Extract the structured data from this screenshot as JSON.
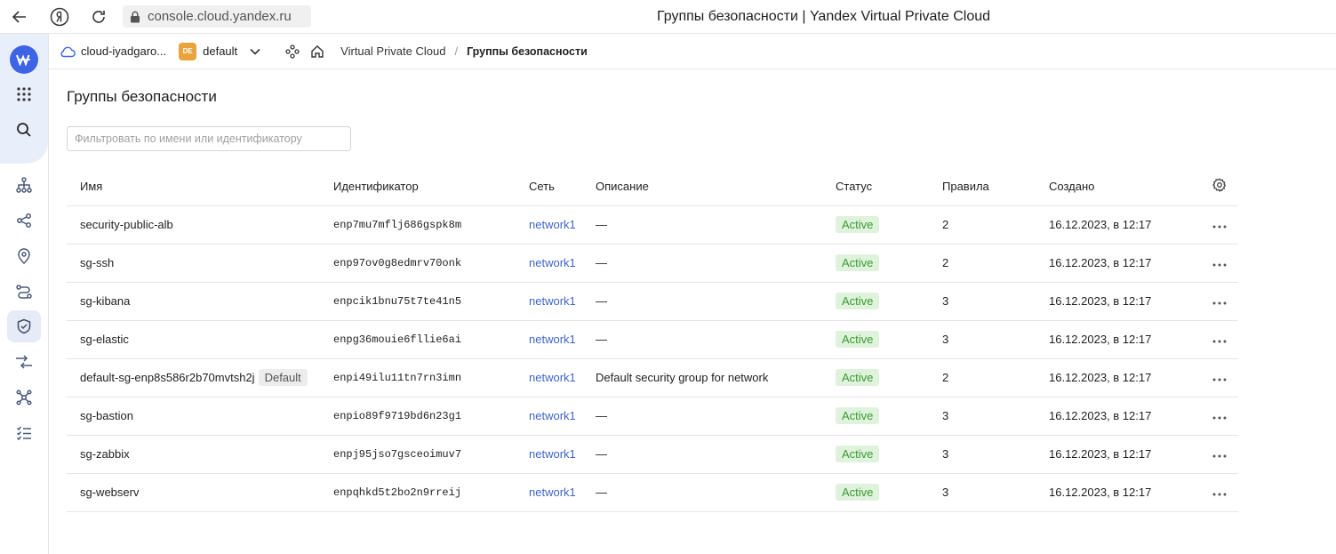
{
  "browser": {
    "url": "console.cloud.yandex.ru",
    "title": "Группы безопасности | Yandex Virtual Private Cloud"
  },
  "header": {
    "cloud": "cloud-iyadgaro...",
    "folder_badge": "DE",
    "folder": "default",
    "service": "Virtual Private Cloud",
    "separator": "/",
    "current": "Группы безопасности"
  },
  "page": {
    "title": "Группы безопасности",
    "filter_placeholder": "Фильтровать по имени или идентификатору"
  },
  "table": {
    "columns": [
      "Имя",
      "Идентификатор",
      "Сеть",
      "Описание",
      "Статус",
      "Правила",
      "Создано"
    ],
    "rows": [
      {
        "name": "security-public-alb",
        "tag": "",
        "id": "enp7mu7mflj686gspk8m",
        "network": "network1",
        "description": "—",
        "status": "Active",
        "rules": "2",
        "created": "16.12.2023, в 12:17"
      },
      {
        "name": "sg-ssh",
        "tag": "",
        "id": "enp97ov0g8edmrv70onk",
        "network": "network1",
        "description": "—",
        "status": "Active",
        "rules": "2",
        "created": "16.12.2023, в 12:17"
      },
      {
        "name": "sg-kibana",
        "tag": "",
        "id": "enpcik1bnu75t7te41n5",
        "network": "network1",
        "description": "—",
        "status": "Active",
        "rules": "3",
        "created": "16.12.2023, в 12:17"
      },
      {
        "name": "sg-elastic",
        "tag": "",
        "id": "enpg36mouie6fllie6ai",
        "network": "network1",
        "description": "—",
        "status": "Active",
        "rules": "3",
        "created": "16.12.2023, в 12:17"
      },
      {
        "name": "default-sg-enp8s586r2b70mvtsh2j",
        "tag": "Default",
        "id": "enpi49ilu11tn7rn3imn",
        "network": "network1",
        "description": "Default security group for network",
        "status": "Active",
        "rules": "2",
        "created": "16.12.2023, в 12:17"
      },
      {
        "name": "sg-bastion",
        "tag": "",
        "id": "enpio89f9719bd6n23g1",
        "network": "network1",
        "description": "—",
        "status": "Active",
        "rules": "3",
        "created": "16.12.2023, в 12:17"
      },
      {
        "name": "sg-zabbix",
        "tag": "",
        "id": "enpj95jso7gsceoimuv7",
        "network": "network1",
        "description": "—",
        "status": "Active",
        "rules": "3",
        "created": "16.12.2023, в 12:17"
      },
      {
        "name": "sg-webserv",
        "tag": "",
        "id": "enpqhkd5t2bo2n9rreij",
        "network": "network1",
        "description": "—",
        "status": "Active",
        "rules": "3",
        "created": "16.12.2023, в 12:17"
      }
    ]
  },
  "icons": {
    "back": "arrow-left-icon",
    "yandex": "yandex-logo-icon",
    "reload": "reload-icon",
    "lock": "lock-icon",
    "rail": [
      "cloud-logo-icon",
      "apps-grid-icon",
      "search-icon",
      "network-icon",
      "share-icon",
      "location-pin-icon",
      "route-icon",
      "shield-icon",
      "exchange-icon",
      "hub-icon",
      "checklist-icon"
    ]
  },
  "colors": {
    "accent": "#3e64e6",
    "link": "#3e64c8",
    "status_bg": "#dff3dc",
    "status_text": "#3a9a32",
    "folder_badge": "#e8a33d"
  }
}
